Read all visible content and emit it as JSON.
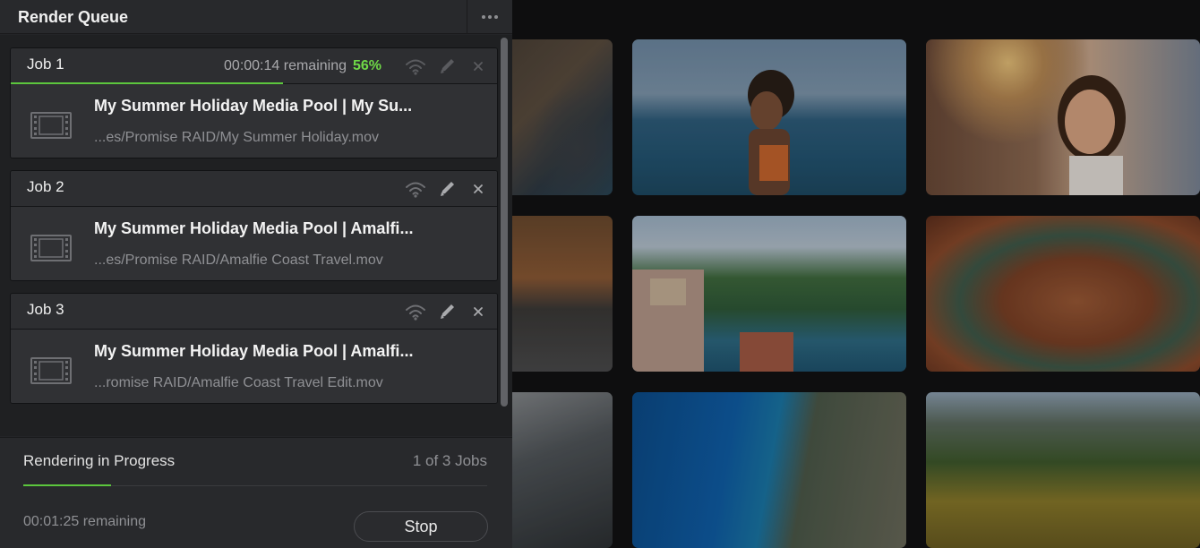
{
  "panel": {
    "title": "Render Queue",
    "more_icon": "more-horizontal-icon"
  },
  "jobs": [
    {
      "name": "Job 1",
      "remaining": "00:00:14 remaining",
      "percent": "56%",
      "progress": 0.56,
      "clip": "My Summer Holiday Media Pool | My Su...",
      "path": "...es/Promise RAID/My Summer Holiday.mov"
    },
    {
      "name": "Job 2",
      "clip": "My Summer Holiday Media Pool | Amalfi...",
      "path": "...es/Promise RAID/Amalfie Coast Travel.mov"
    },
    {
      "name": "Job 3",
      "clip": "My Summer Holiday Media Pool | Amalfi...",
      "path": "...romise RAID/Amalfie Coast Travel Edit.mov"
    }
  ],
  "footer": {
    "status": "Rendering in Progress",
    "jobs_count": "1 of 3 Jobs",
    "overall_progress": 0.19,
    "remaining": "00:01:25 remaining",
    "stop_label": "Stop"
  },
  "colors": {
    "accent_green": "#5cc63d",
    "percent_green": "#6fd847"
  },
  "media_pool": {
    "thumbnails": [
      "coastal-cliffs",
      "woman-by-sea",
      "city-selfie",
      "canyon-road",
      "amalfi-coast",
      "horseshoe-bend",
      "van-interior",
      "blue-bay",
      "mountain-valley"
    ]
  }
}
